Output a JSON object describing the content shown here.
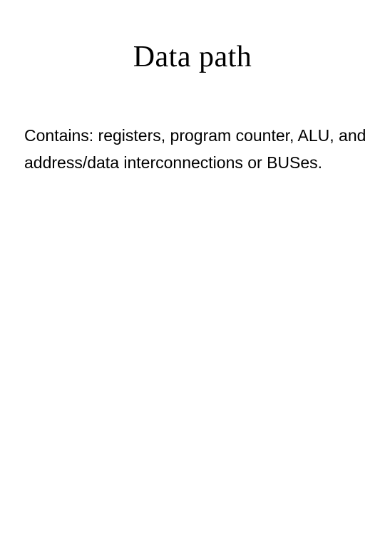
{
  "slide": {
    "title": "Data path",
    "body": "Contains: registers, program counter, ALU, and address/data interconnections or BUSes."
  }
}
